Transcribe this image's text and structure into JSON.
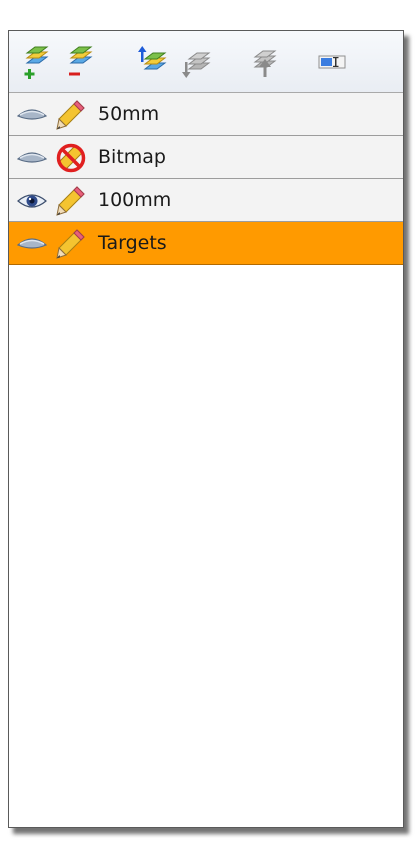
{
  "toolbar": {
    "buttons": [
      {
        "icon": "add-layer-icon",
        "enabled": true
      },
      {
        "icon": "remove-layer-icon",
        "enabled": true
      },
      {
        "icon": "move-layer-up-icon",
        "enabled": true
      },
      {
        "icon": "move-layer-down-icon",
        "enabled": false
      },
      {
        "icon": "merge-layer-icon",
        "enabled": false
      },
      {
        "icon": "rename-layer-icon",
        "enabled": true
      }
    ]
  },
  "layers": [
    {
      "name": "50mm",
      "visible": false,
      "editable": true,
      "selected": false
    },
    {
      "name": "Bitmap",
      "visible": false,
      "editable": false,
      "selected": false
    },
    {
      "name": "100mm",
      "visible": true,
      "editable": true,
      "selected": false
    },
    {
      "name": "Targets",
      "visible": false,
      "editable": true,
      "selected": true
    }
  ],
  "colors": {
    "selected_row": "#ff9a00",
    "row_background": "#f3f3f3",
    "row_border": "#9c9c9c"
  }
}
